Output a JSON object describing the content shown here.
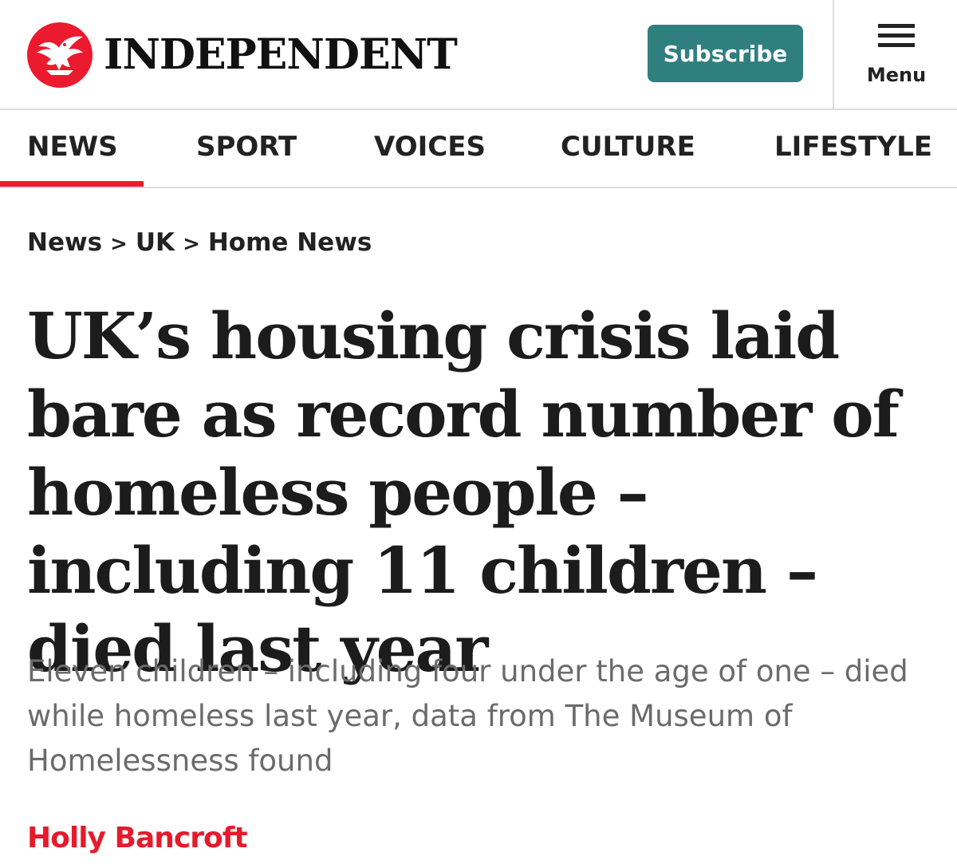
{
  "header": {
    "logo_text": "INDEPENDENT",
    "subscribe_label": "Subscribe",
    "menu_label": "Menu",
    "brand_color": "#ec1a2e",
    "subscribe_color": "#2f7f7f"
  },
  "nav": {
    "items": [
      {
        "label": "NEWS",
        "active": true
      },
      {
        "label": "SPORT",
        "active": false
      },
      {
        "label": "VOICES",
        "active": false
      },
      {
        "label": "CULTURE",
        "active": false
      },
      {
        "label": "LIFESTYLE",
        "active": false
      }
    ]
  },
  "breadcrumb": {
    "items": [
      "News",
      "UK",
      "Home News"
    ],
    "separator": ">"
  },
  "article": {
    "headline": "UK’s housing crisis laid bare as record number of homeless people – including 11 children – died last year",
    "standfirst": "Eleven children – including four under the age of one – died while homeless last year, data from The Museum of Homelessness found",
    "author": "Holly Bancroft"
  },
  "icons": {
    "logo": "eagle-logo-icon",
    "menu": "hamburger-menu-icon"
  }
}
